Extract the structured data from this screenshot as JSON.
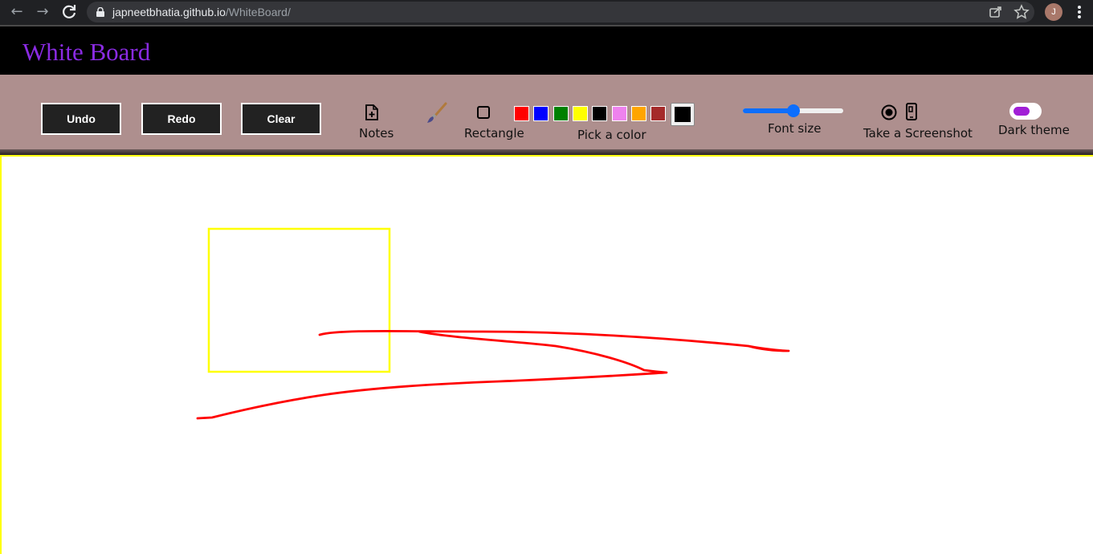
{
  "browser": {
    "url_host": "japneetbhatia.github.io",
    "url_path": "/WhiteBoard/",
    "avatar_initial": "J"
  },
  "app": {
    "title": "White Board",
    "title_color": "#8a2be2"
  },
  "toolbar": {
    "undo_label": "Undo",
    "redo_label": "Redo",
    "clear_label": "Clear",
    "notes_label": "Notes",
    "rectangle_label": "Rectangle",
    "pick_color_label": "Pick a color",
    "palette": [
      "#ff0000",
      "#0000ff",
      "#008000",
      "#ffff00",
      "#000000",
      "#ee82ee",
      "#ffa500",
      "#a52a2a"
    ],
    "current_color": "#000000",
    "font_size_label": "Font size",
    "font_size_fraction": 0.5,
    "screenshot_label": "Take a Screenshot",
    "dark_theme_label": "Dark theme",
    "dark_theme_on": true
  },
  "canvas": {
    "border_color": "#ffff00",
    "stroke_colors": {
      "rectangle": "#ffff00",
      "freehand": "#ff0000"
    }
  },
  "icons": {
    "back": "arrow-left-icon",
    "forward": "arrow-right-icon",
    "reload": "reload-icon",
    "lock": "lock-icon",
    "share": "share-icon",
    "bookmark": "star-icon",
    "menu": "kebab-menu-icon",
    "notes": "file-plus-icon",
    "brush": "paintbrush-icon",
    "rectangle": "square-icon",
    "record": "record-icon",
    "phone": "phone-icon"
  }
}
